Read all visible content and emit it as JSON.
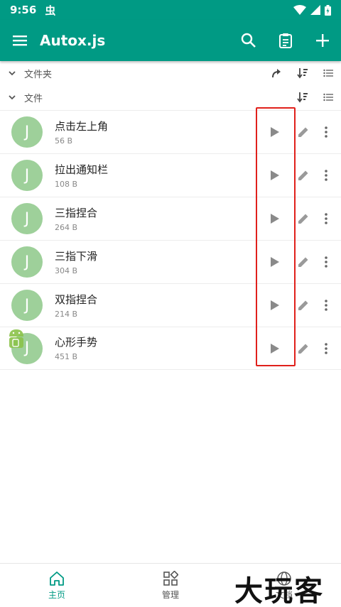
{
  "status_bar": {
    "time": "9:56",
    "app_glyph": "虫"
  },
  "app_bar": {
    "title": "Autox.js"
  },
  "sections": {
    "folders": {
      "label": "文件夹"
    },
    "files": {
      "label": "文件"
    }
  },
  "files": [
    {
      "avatar_letter": "J",
      "name": "点击左上角",
      "size": "56 B"
    },
    {
      "avatar_letter": "J",
      "name": "拉出通知栏",
      "size": "108 B"
    },
    {
      "avatar_letter": "J",
      "name": "三指捏合",
      "size": "264 B"
    },
    {
      "avatar_letter": "J",
      "name": "三指下滑",
      "size": "304 B"
    },
    {
      "avatar_letter": "J",
      "name": "双指捏合",
      "size": "214 B"
    },
    {
      "avatar_letter": "J",
      "name": "心形手势",
      "size": "451 B"
    }
  ],
  "bottom_nav": {
    "home": "主页",
    "manage": "管理",
    "docs": "文档"
  },
  "watermark": "大玩客",
  "colors": {
    "primary": "#009a84",
    "avatar": "#9ed09a",
    "highlight_border": "#e0201b"
  }
}
